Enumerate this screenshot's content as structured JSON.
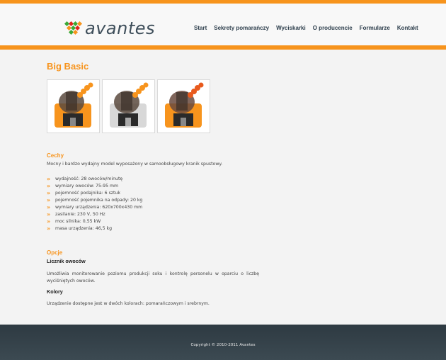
{
  "header": {
    "logo_text": "avantes",
    "nav": [
      "Start",
      "Sekrety pomarańczy",
      "Wyciskarki",
      "O producencie",
      "Formularze",
      "Kontakt"
    ]
  },
  "product": {
    "title": "Big Basic",
    "thumbnails": [
      {
        "variant": "orange",
        "color": "#f7941d"
      },
      {
        "variant": "silver",
        "color": "#d8d8d8"
      },
      {
        "variant": "orange",
        "color": "#f7941d"
      }
    ]
  },
  "features": {
    "heading": "Cechy",
    "intro": "Mocny i bardzo wydajny model wyposażony w samoobsługowy kranik spustowy.",
    "items": [
      "wydajność: 28 owoców/minutę",
      "wymiary owoców: 75-95 mm",
      "pojemność podajnika: 6 sztuk",
      "pojemność pojemnika na odpady: 20 kg",
      "wymiary urządzenia: 620x700x430 mm",
      "zasilanie: 230 V, 50 Hz",
      "moc silnika: 0,55 kW",
      "masa urządzenia: 46,5 kg"
    ],
    "bullet": "»"
  },
  "options": {
    "heading": "Opcje",
    "counter_label": "Licznik owoców",
    "counter_text": "Umożliwia monitorowanie poziomu produkcji soku i kontrolę personelu w oparciu o liczbę wyciśniętych owoców.",
    "colors_label": "Kolory",
    "colors_text": "Urządzenie dostępne jest w dwóch kolorach: pomarańczowym i srebrnym."
  },
  "footer": {
    "copyright": "Copyright © 2010-2011 Avantes"
  },
  "colors": {
    "accent": "#f7941d",
    "logo_green": "#3aa935",
    "logo_red": "#e2231a",
    "footer_bg": "#333f47"
  }
}
